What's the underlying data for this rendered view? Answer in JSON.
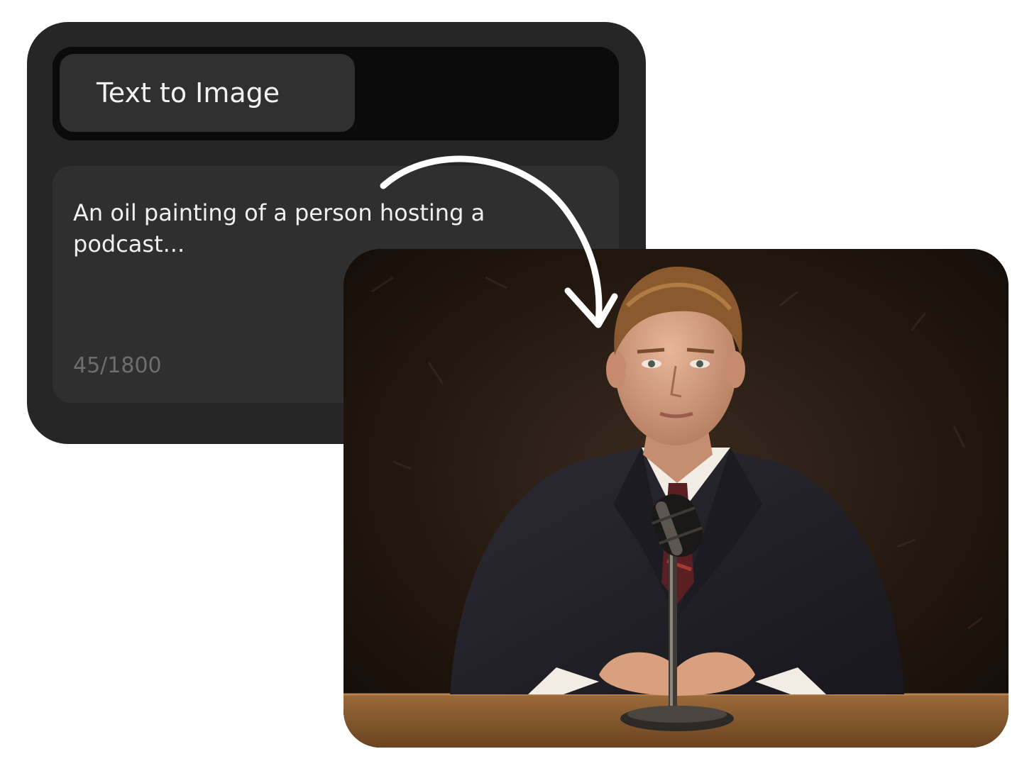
{
  "tabs": {
    "active_label": "Text to Image"
  },
  "prompt": {
    "text": "An oil painting of a person hosting a podcast...",
    "char_count": "45/1800"
  },
  "result_image": {
    "subject": "oil painting portrait of a man in a dark suit at a podcast microphone"
  },
  "colors": {
    "panel_bg": "#262626",
    "tab_bar_bg": "#0b0b0b",
    "tab_active_bg": "#303030",
    "prompt_bg": "#2f2f2f",
    "arrow": "#ffffff"
  },
  "icons": {
    "arrow": "curved-arrow-icon"
  }
}
